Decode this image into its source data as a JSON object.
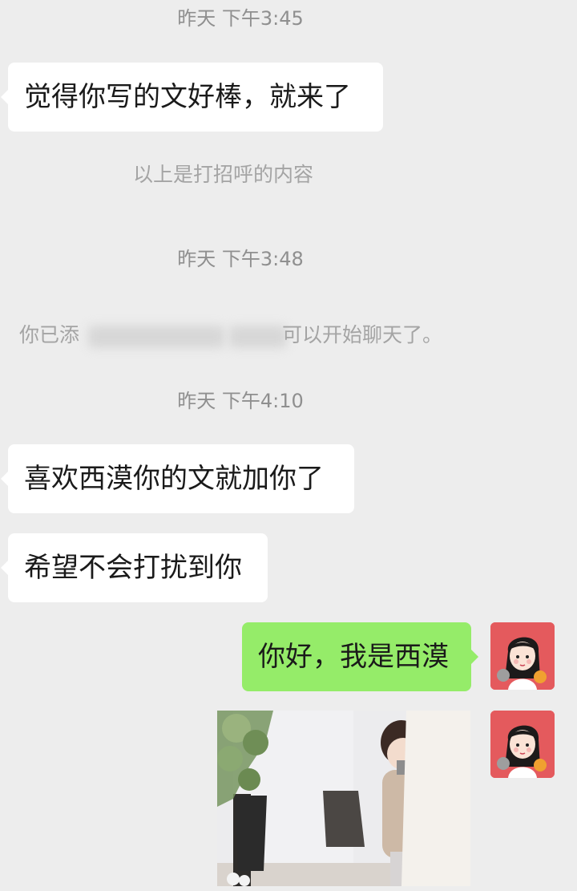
{
  "chat": {
    "time_1": "昨天 下午3:45",
    "msg_1": "觉得你写的文好棒，就来了",
    "greeting_note": "以上是打招呼的内容",
    "time_2": "昨天 下午3:48",
    "friend_added": {
      "prefix": "你已添",
      "suffix": "可以开始聊天了。"
    },
    "time_3": "昨天 下午4:10",
    "msg_2": "喜欢西漠你的文就加你了",
    "msg_3": "希望不会打扰到你",
    "msg_me_1": "你好，我是西漠"
  },
  "colors": {
    "background": "#ededed",
    "incoming_bubble": "#ffffff",
    "outgoing_bubble": "#95ec69",
    "avatar_background": "#e45a5d"
  },
  "icons": {
    "my_avatar": "girl-avatar",
    "photo_message": "photo-thumbnail"
  }
}
